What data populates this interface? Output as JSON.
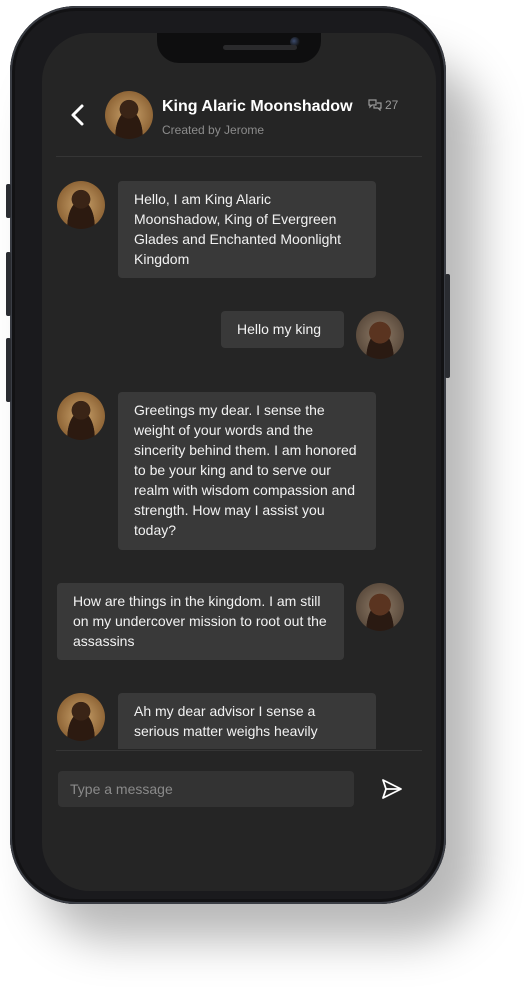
{
  "header": {
    "bot_name": "King Alaric Moonshadow",
    "chat_count": "27",
    "created_by": "Created by Jerome"
  },
  "messages": [
    {
      "sender": "bot",
      "text": "Hello, I am King Alaric Moonshadow, King of Evergreen Glades and Enchanted Moonlight Kingdom"
    },
    {
      "sender": "user",
      "text": "Hello my king"
    },
    {
      "sender": "bot",
      "text": "Greetings my dear. I sense the weight of your words and the sincerity behind them. I am honored to be your king and to serve our realm with wisdom compassion and strength. How may I assist you today?"
    },
    {
      "sender": "user",
      "text": "How are things in the kingdom. I am still on my undercover mission to root out the assassins"
    },
    {
      "sender": "bot",
      "text": "Ah my dear advisor I sense a serious matter weighs heavily"
    }
  ],
  "composer": {
    "placeholder": "Type a message"
  },
  "icons": {
    "back": "chevron-left-icon",
    "chats": "chat-bubbles-icon",
    "send": "send-icon"
  },
  "colors": {
    "screen_bg": "#252525",
    "bubble_bg": "#393939",
    "text": "#f2f2f2"
  }
}
